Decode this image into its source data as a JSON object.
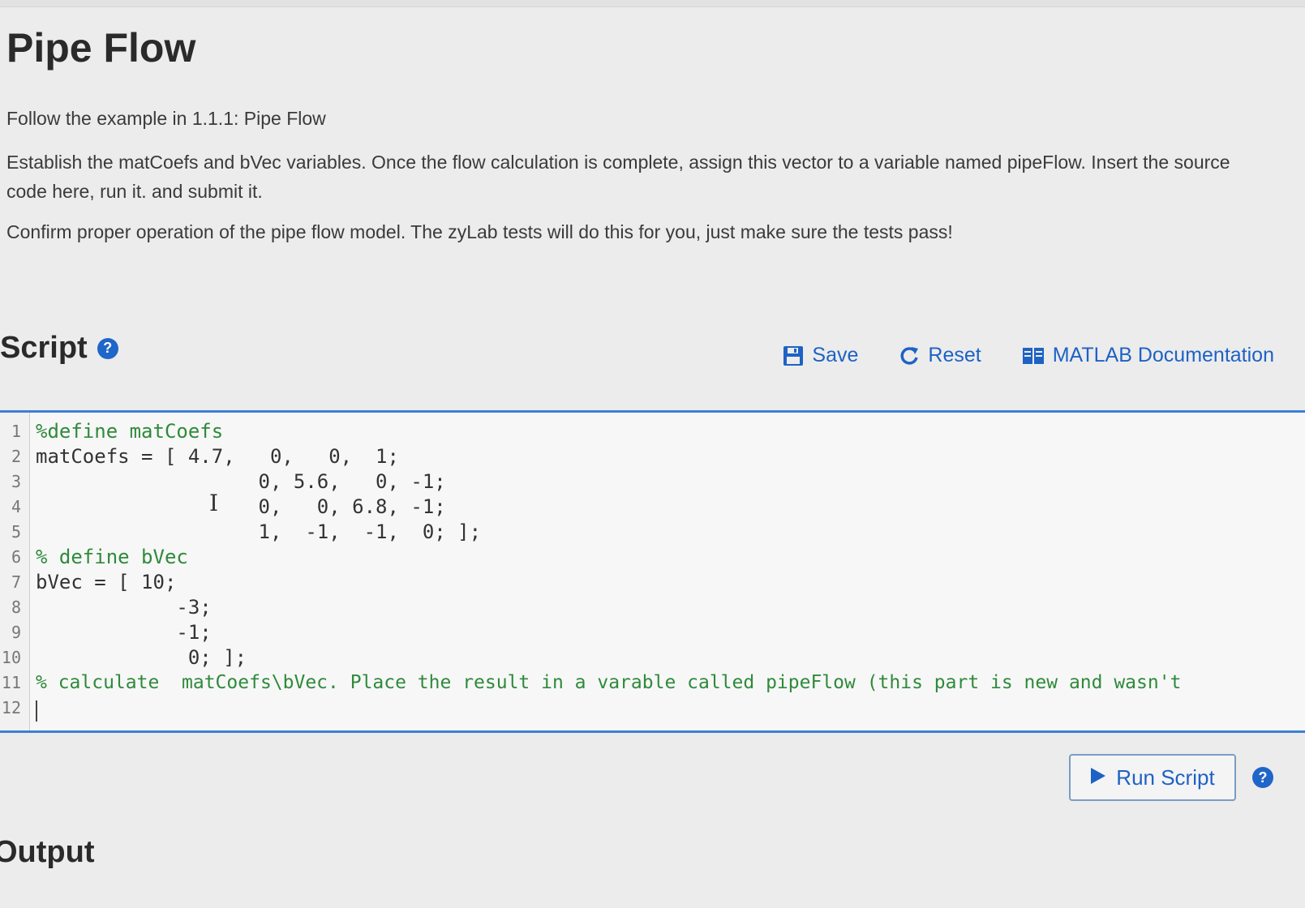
{
  "page": {
    "title": "Pipe Flow",
    "paragraphs": [
      "Follow the example in 1.1.1: Pipe Flow",
      "Establish the matCoefs and bVec variables. Once the flow calculation is complete, assign this vector to a variable named pipeFlow. Insert the source code here, run it. and submit it.",
      "Confirm proper operation of the pipe flow model. The zyLab tests will do this for you, just make sure the tests pass!"
    ]
  },
  "script": {
    "title": "Script",
    "help_icon": "?",
    "toolbar": {
      "save_label": "Save",
      "reset_label": "Reset",
      "docs_label": "MATLAB Documentation"
    }
  },
  "editor": {
    "line_numbers": [
      "1",
      "2",
      "3",
      "4",
      "5",
      "6",
      "7",
      "8",
      "9",
      "10",
      "11",
      "12"
    ],
    "lines": [
      "%define matCoefs",
      "matCoefs = [ 4.7,   0,   0,  1;",
      "                   0, 5.6,   0, -1;",
      "                   0,   0, 6.8, -1;",
      "                   1,  -1,  -1,  0; ];",
      "% define bVec",
      "bVec = [ 10;",
      "            -3;",
      "            -1;",
      "             0; ];",
      "% calculate  matCoefs\\bVec. Place the result in a varable called pipeFlow (this part is new and wasn't",
      ""
    ]
  },
  "run": {
    "label": "Run Script",
    "help_icon": "?"
  },
  "output": {
    "title": "Output"
  },
  "colors": {
    "accent": "#1e62c5",
    "comment": "#2f8a3b",
    "editor_border": "#3d7fd6"
  }
}
